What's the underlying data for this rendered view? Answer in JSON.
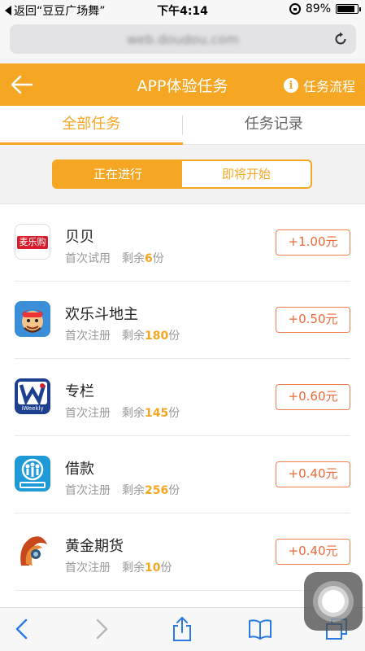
{
  "status_bar": {
    "back_label": "返回“豆豆广场舞”",
    "time": "下午4:14",
    "battery": "89%"
  },
  "browser": {
    "url": "web.doudou.com"
  },
  "header": {
    "title": "APP体验任务",
    "flow_label": "任务流程",
    "accent_color": "#f5a623"
  },
  "tabs": [
    {
      "label": "全部任务",
      "active": true
    },
    {
      "label": "任务记录",
      "active": false
    }
  ],
  "segment": [
    {
      "label": "正在进行",
      "active": true
    },
    {
      "label": "即将开始",
      "active": false
    }
  ],
  "tasks": [
    {
      "name": "贝贝",
      "type": "首次试用",
      "remain_label": "剩余",
      "count": "6",
      "unit": "份",
      "reward": "+1.00元",
      "icon": "maileguo-logo",
      "icon_text": "麦乐购"
    },
    {
      "name": "欢乐斗地主",
      "type": "首次注册",
      "remain_label": "剩余",
      "count": "180",
      "unit": "份",
      "reward": "+0.50元",
      "icon": "doudizhu-logo"
    },
    {
      "name": "专栏",
      "type": "首次注册",
      "remain_label": "剩余",
      "count": "145",
      "unit": "份",
      "reward": "+0.60元",
      "icon": "iweekly-logo",
      "icon_text": "iWeekly"
    },
    {
      "name": "借款",
      "type": "首次注册",
      "remain_label": "剩余",
      "count": "256",
      "unit": "份",
      "reward": "+0.40元",
      "icon": "jiekuan-logo"
    },
    {
      "name": "黄金期货",
      "type": "首次注册",
      "remain_label": "剩余",
      "count": "10",
      "unit": "份",
      "reward": "+0.40元",
      "icon": "gold-futures-logo"
    }
  ],
  "toolbar": {
    "items": [
      "back-icon",
      "forward-icon",
      "share-icon",
      "bookmarks-icon",
      "tabs-icon"
    ]
  }
}
